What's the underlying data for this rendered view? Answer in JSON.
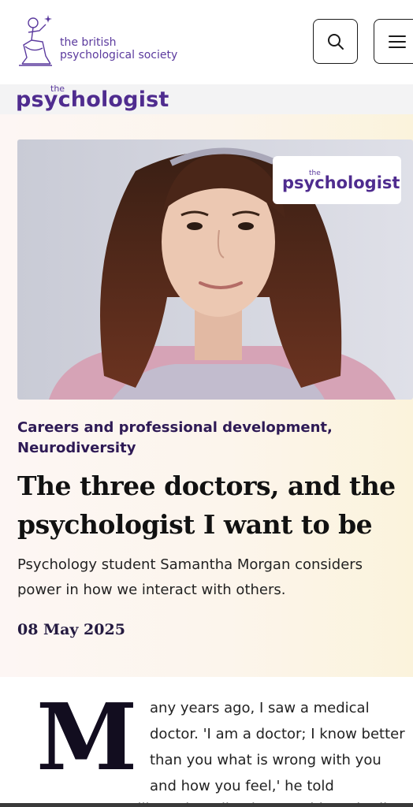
{
  "header": {
    "org_name_line1": "the british",
    "org_name_line2": "psychological society",
    "search_icon": "search-icon",
    "menu_icon": "hamburger-menu-icon"
  },
  "brand": {
    "the": "the",
    "name": "psychologist"
  },
  "hero": {
    "photo_badge_the": "the",
    "photo_badge_name": "psychologist",
    "categories": "Careers and professional development, Neurodiversity",
    "headline": "The three doctors, and the psychologist I want to be",
    "standfirst": "Psychology student Samantha Morgan considers power in how we interact with others.",
    "date": "08 May 2025"
  },
  "article": {
    "drop_cap": "M",
    "first_paragraph": "any years ago, I saw a medical doctor. 'I am a doctor; I know better than you what is wrong with you and how you feel,' he told",
    "partial_line": "me. 'You will need medication to address it all'"
  },
  "colors": {
    "brand_purple": "#4f2c8f",
    "category_text": "#2e1a55"
  }
}
